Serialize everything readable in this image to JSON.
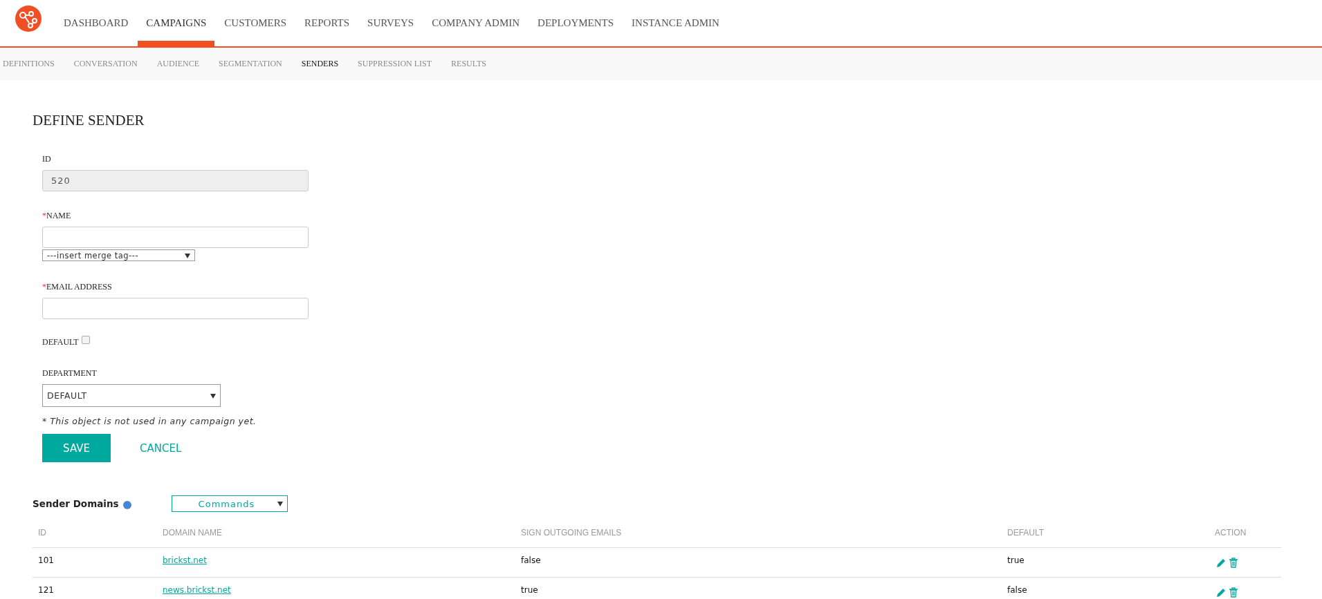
{
  "nav": {
    "items": [
      {
        "label": "DASHBOARD",
        "selected": false
      },
      {
        "label": "CAMPAIGNS",
        "selected": true
      },
      {
        "label": "CUSTOMERS",
        "selected": false
      },
      {
        "label": "REPORTS",
        "selected": false
      },
      {
        "label": "SURVEYS",
        "selected": false
      },
      {
        "label": "COMPANY ADMIN",
        "selected": false
      },
      {
        "label": "DEPLOYMENTS",
        "selected": false
      },
      {
        "label": "INSTANCE ADMIN",
        "selected": false
      }
    ]
  },
  "subnav": {
    "items": [
      {
        "label": "DEFINITIONS",
        "selected": false
      },
      {
        "label": "CONVERSATION",
        "selected": false
      },
      {
        "label": "AUDIENCE",
        "selected": false
      },
      {
        "label": "SEGMENTATION",
        "selected": false
      },
      {
        "label": "SENDERS",
        "selected": true
      },
      {
        "label": "SUPPRESSION LIST",
        "selected": false
      },
      {
        "label": "RESULTS",
        "selected": false
      }
    ]
  },
  "form": {
    "title": "DEFINE SENDER",
    "id": {
      "label": "ID",
      "value": "520"
    },
    "name": {
      "required_mark": "*",
      "label": "NAME",
      "merge_tag": "---insert merge tag---"
    },
    "email": {
      "required_mark": "*",
      "label": "EMAIL ADDRESS"
    },
    "default": {
      "label": "DEFAULT",
      "checked": false
    },
    "department": {
      "label": "DEPARTMENT",
      "value": "DEFAULT"
    },
    "note": "* This object is not used in any campaign yet.",
    "buttons": {
      "save": "SAVE",
      "cancel": "CANCEL"
    }
  },
  "domains": {
    "title": "Sender Domains",
    "commands": "Commands",
    "columns": [
      "ID",
      "DOMAIN NAME",
      "SIGN OUTGOING EMAILS",
      "DEFAULT",
      "ACTION"
    ],
    "rows": [
      {
        "id": "101",
        "domain": "brickst.net",
        "sign": "false",
        "default": "true"
      },
      {
        "id": "121",
        "domain": "news.brickst.net",
        "sign": "true",
        "default": "false"
      }
    ]
  }
}
